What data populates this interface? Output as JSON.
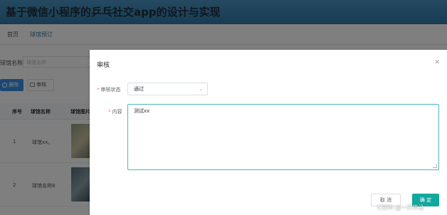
{
  "header": {
    "title": "基于微信小程序的乒乓社交app的设计与实现"
  },
  "nav": {
    "items": [
      {
        "label": "首页",
        "active": false
      },
      {
        "label": "球馆预订",
        "active": true
      }
    ]
  },
  "search": {
    "label": "球馆名称",
    "placeholder": "球馆名称"
  },
  "toolbar": {
    "delete_label": "删除",
    "audit_label": "审核"
  },
  "table": {
    "headers": [
      "序号",
      "球馆名称",
      "球馆图片"
    ],
    "rows": [
      {
        "index": "1",
        "name": "球馆xx。"
      },
      {
        "index": "2",
        "name": "球馆名称8"
      }
    ]
  },
  "dialog": {
    "title": "审核",
    "close_icon": "close-icon",
    "status_label": "审核状态",
    "status_value": "通过",
    "content_label": "内容",
    "content_value": "测试xx",
    "cancel_label": "取 消",
    "ok_label": "确 定"
  },
  "watermark": "CSDN @一只毕设",
  "colors": {
    "header": "#2f78a8",
    "primary": "#3a8ee6",
    "confirm": "#13a89e",
    "focus_border": "#4fb4c7"
  }
}
